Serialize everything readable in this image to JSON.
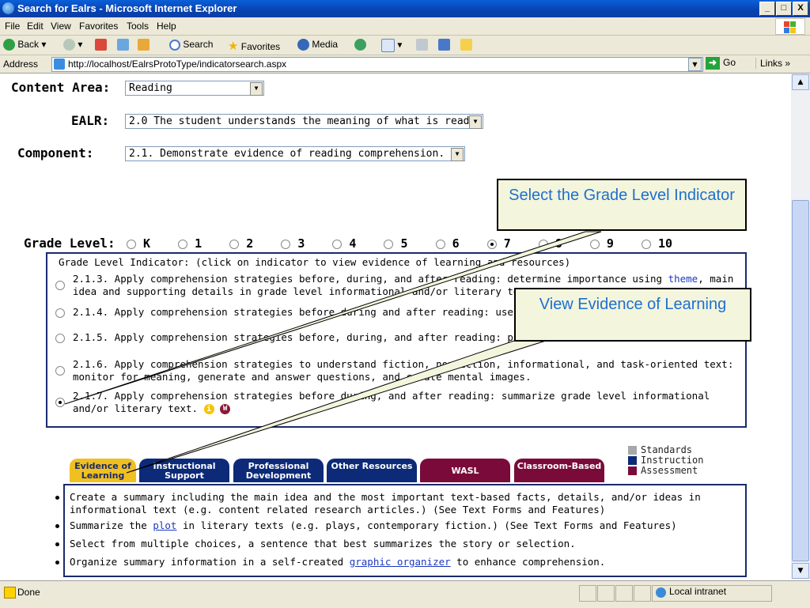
{
  "window": {
    "title": "Search for Ealrs - Microsoft Internet Explorer",
    "min": "_",
    "max": "□",
    "close": "X"
  },
  "menu": [
    "File",
    "Edit",
    "View",
    "Favorites",
    "Tools",
    "Help"
  ],
  "toolbar": {
    "back": "Back",
    "search": "Search",
    "favorites": "Favorites",
    "media": "Media"
  },
  "address": {
    "label": "Address",
    "url": "http://localhost/EalrsProtoType/indicatorsearch.aspx",
    "go": "Go",
    "links": "Links"
  },
  "form": {
    "content_area_label": "Content Area:",
    "content_area_value": "Reading",
    "ealr_label": "EALR:",
    "ealr_value": "2.0 The student understands the meaning of what is read.",
    "component_label": "Component:",
    "component_value": "2.1. Demonstrate evidence of reading comprehension.",
    "grade_level_label": "Grade Level:",
    "grades": [
      "K",
      "1",
      "2",
      "3",
      "4",
      "5",
      "6",
      "7",
      "8",
      "9",
      "10"
    ],
    "selected_grade": "7"
  },
  "indicators": {
    "header": "Grade Level Indicator:  (click on indicator to view evidence of learning and resources)",
    "items": [
      {
        "text_before": "2.1.3. Apply comprehension strategies before, during, and after reading: determine importance using ",
        "link": "theme",
        "text_after": ", main idea and supporting details in grade level informational and/or literary text."
      },
      {
        "text": "2.1.4. Apply comprehension strategies before during and after reading: use prior knowledge."
      },
      {
        "text": "2.1.5. Apply comprehension strategies before, during, and after reading: predict and infer."
      },
      {
        "text": "2.1.6. Apply comprehension strategies to understand fiction, nonfiction, informational, and task-oriented text: monitor for meaning, generate and answer questions, and create mental images."
      },
      {
        "text": "2.1.7. Apply comprehension strategies before during, and after reading: summarize grade level informational and/or literary text.",
        "selected": true
      }
    ]
  },
  "tabs": [
    {
      "label": "Evidence of Learning",
      "color": "#f0c020",
      "text_color": "#1a2a6c"
    },
    {
      "label": "Instructional Support",
      "color": "#0d2a78",
      "text_color": "#ffffff"
    },
    {
      "label": "Professional Development",
      "color": "#0d2a78",
      "text_color": "#ffffff"
    },
    {
      "label": "Other Resources",
      "color": "#0d2a78",
      "text_color": "#ffffff"
    },
    {
      "label": "WASL",
      "color": "#7a0a3a",
      "text_color": "#ffffff"
    },
    {
      "label": "Classroom-Based",
      "color": "#7a0a3a",
      "text_color": "#ffffff"
    }
  ],
  "legend": [
    {
      "label": "Standards",
      "color": "#a8a8a8"
    },
    {
      "label": "Instruction",
      "color": "#0d2a78"
    },
    {
      "label": "Assessment",
      "color": "#7a0a3a"
    }
  ],
  "evidence": [
    {
      "text": "Create a summary including the main idea and the most important text-based facts, details, and/or ideas in informational text (e.g. content related research articles.) (See Text Forms and Features)"
    },
    {
      "text_before": "Summarize the ",
      "link": "plot",
      "text_after": " in literary texts (e.g. plays, contemporary fiction.) (See Text Forms and Features)"
    },
    {
      "text": "Select from multiple choices, a sentence that best summarizes the story or selection."
    },
    {
      "text_before": "Organize summary information in a self-created ",
      "link": "graphic organizer",
      "text_after": " to enhance comprehension."
    }
  ],
  "callouts": {
    "grade": "Select the Grade Level Indicator",
    "evidence": "View Evidence of Learning"
  },
  "status": {
    "text": "Done",
    "zone": "Local intranet"
  }
}
